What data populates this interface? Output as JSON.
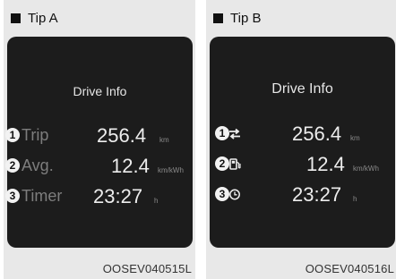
{
  "tip_a": {
    "title": "Tip A",
    "screen_title": "Drive Info",
    "rows": [
      {
        "num": "1",
        "label": "Trip",
        "value": "256.4",
        "unit": "km"
      },
      {
        "num": "2",
        "label": "Avg.",
        "value": "12.4",
        "unit": "km/kWh"
      },
      {
        "num": "3",
        "label": "Timer",
        "value": "23:27",
        "unit": "h"
      }
    ],
    "code": "OOSEV040515L"
  },
  "tip_b": {
    "title": "Tip B",
    "screen_title": "Drive Info",
    "rows": [
      {
        "num": "1",
        "icon": "trip-arrows-icon",
        "value": "256.4",
        "unit": "km"
      },
      {
        "num": "2",
        "icon": "fuel-pump-icon",
        "value": "12.4",
        "unit": "km/kWh"
      },
      {
        "num": "3",
        "icon": "clock-icon",
        "value": "23:27",
        "unit": "h"
      }
    ],
    "code": "OOSEV040516L"
  }
}
